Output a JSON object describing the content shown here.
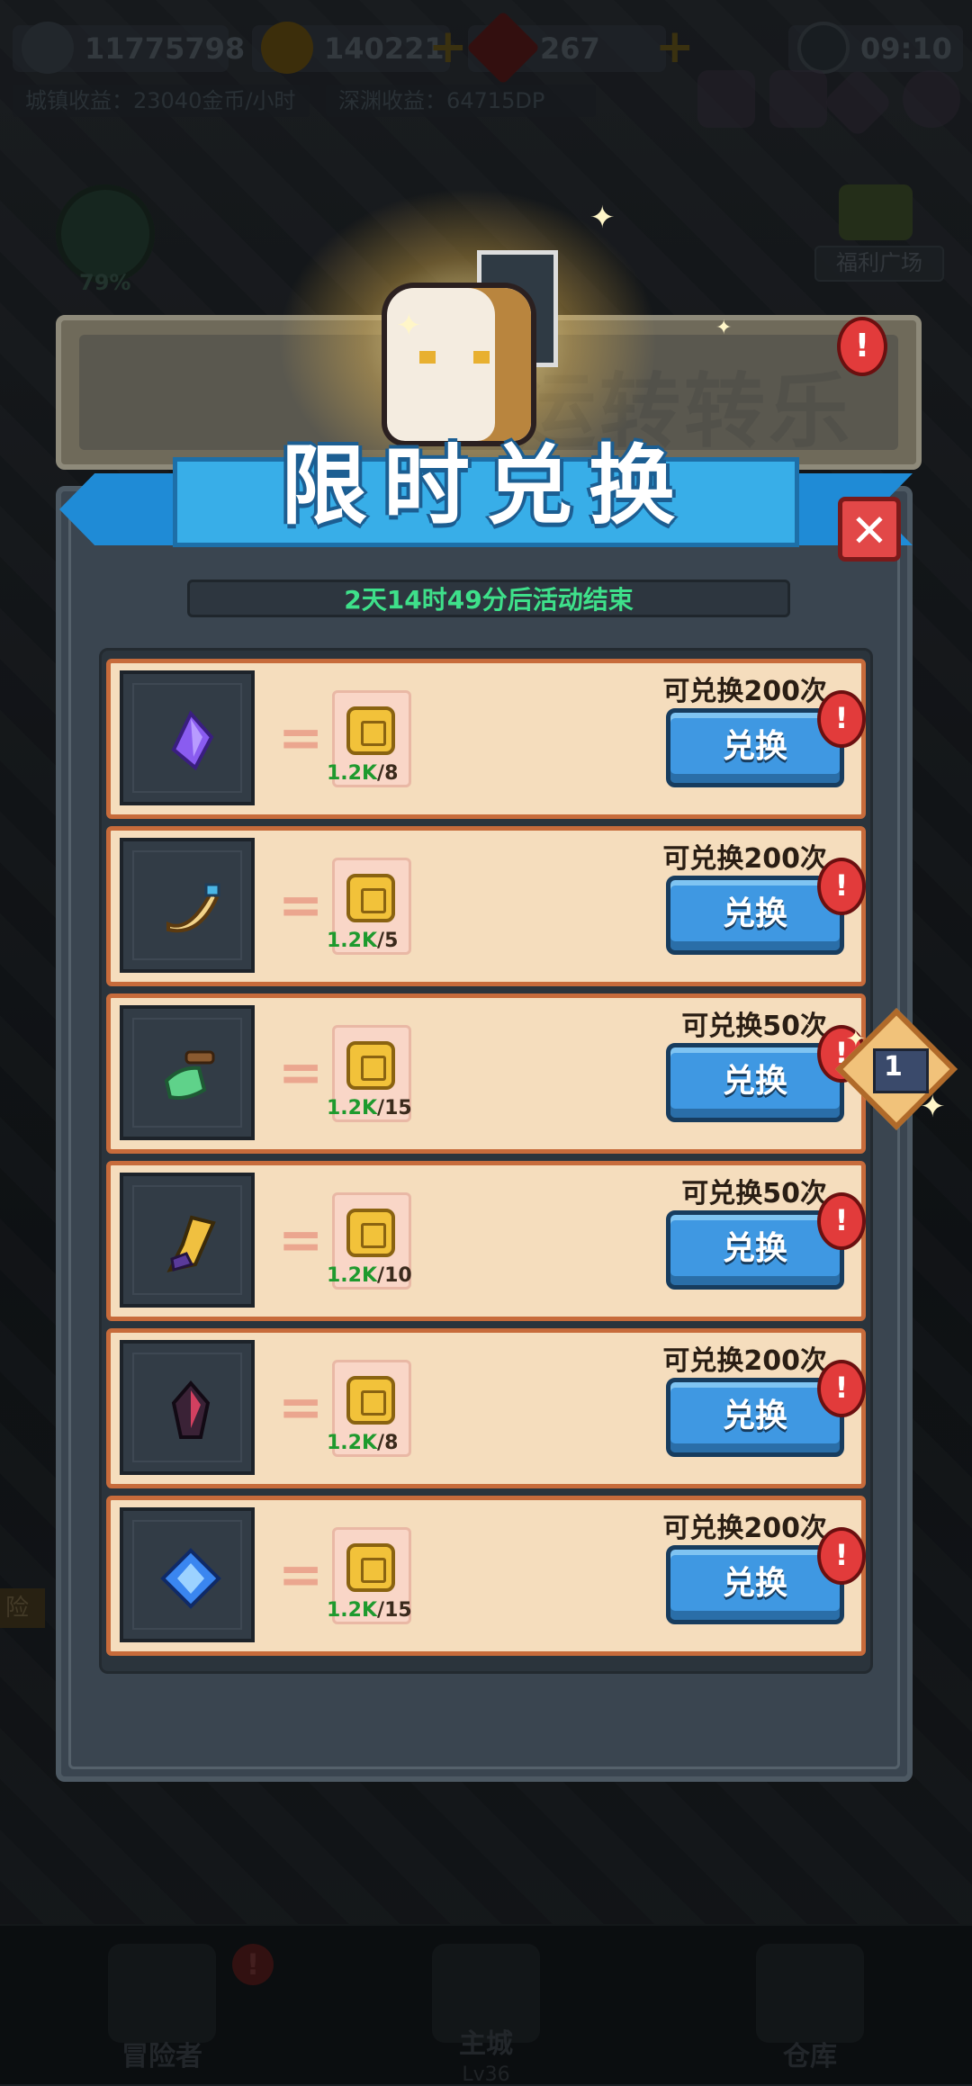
{
  "hud": {
    "power": "11775798",
    "coins": "140221",
    "gems": "267",
    "time": "09:10",
    "city_income": "城镇收益：23040金币/小时",
    "abyss_income": "深渊收益：64715DP",
    "power_icon": "sword-icon",
    "coin_icon": "coin-icon",
    "gem_icon": "ruby-icon",
    "clock_icon": "clock-icon"
  },
  "side": {
    "cube_percent": "79%",
    "welfare_label": "福利广场",
    "left_label": "险"
  },
  "background_banner": {
    "text": "运转转乐"
  },
  "modal": {
    "title": "限时兑换",
    "countdown": "2天14时49分后活动结束",
    "close_label": "✕",
    "exchange_label": "兑换",
    "items": [
      {
        "icon": "purple-crystal-icon",
        "have": "1.2K",
        "need": "/8",
        "limit": "可兑换200次"
      },
      {
        "icon": "horn-icon",
        "have": "1.2K",
        "need": "/5",
        "limit": "可兑换200次"
      },
      {
        "icon": "green-scroll-icon",
        "have": "1.2K",
        "need": "/15",
        "limit": "可兑换50次"
      },
      {
        "icon": "purple-scroll-icon",
        "have": "1.2K",
        "need": "/10",
        "limit": "可兑换50次"
      },
      {
        "icon": "dark-gem-icon",
        "have": "1.2K",
        "need": "/8",
        "limit": "可兑换200次"
      },
      {
        "icon": "blue-ticket-icon",
        "have": "1.2K",
        "need": "/15",
        "limit": "可兑换200次"
      }
    ]
  },
  "floating_reward": {
    "count": "1"
  },
  "nav": {
    "adventurer": "冒险者",
    "main_city": "主城",
    "main_city_level": "Lv36",
    "warehouse": "仓库"
  },
  "colors": {
    "accent_blue": "#3f98e2",
    "countdown_green": "#3ee08a",
    "row_bg": "#f5ddbd",
    "badge_red": "#e23b3b"
  }
}
